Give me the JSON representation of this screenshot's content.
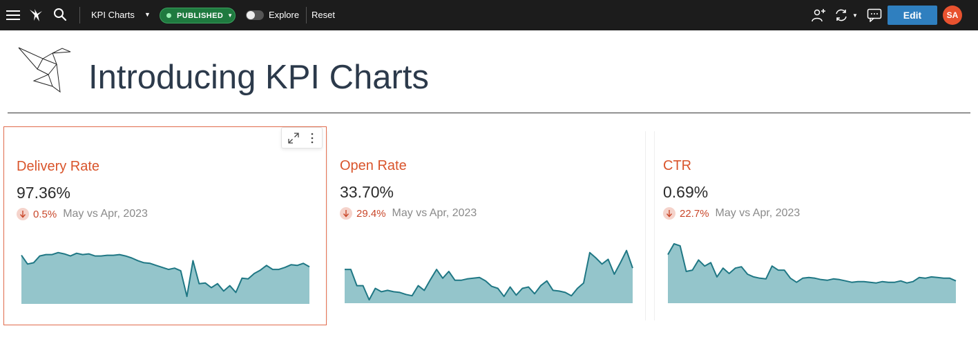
{
  "topbar": {
    "dashboard_name": "KPI Charts",
    "status_badge": "PUBLISHED",
    "explore_label": "Explore",
    "reset_label": "Reset",
    "edit_label": "Edit",
    "avatar_initials": "SA"
  },
  "page": {
    "title": "Introducing KPI Charts"
  },
  "colors": {
    "accent": "#d9542b",
    "spark_fill": "#94c5cb",
    "spark_line": "#1f7784",
    "edit_button": "#2f7fbf",
    "published": "#1f7a3f"
  },
  "cards": [
    {
      "title": "Delivery Rate",
      "value": "97.36%",
      "delta": "0.5%",
      "comparison": "May vs Apr, 2023",
      "direction": "down",
      "spark": [
        72,
        59,
        61,
        71,
        73,
        73,
        76,
        74,
        71,
        75,
        73,
        74,
        71,
        71,
        72,
        72,
        73,
        71,
        68,
        64,
        61,
        60,
        57,
        54,
        51,
        53,
        49,
        11,
        64,
        30,
        31,
        24,
        30,
        19,
        27,
        17,
        38,
        37,
        45,
        50,
        57,
        51,
        51,
        54,
        58,
        57,
        60,
        55
      ]
    },
    {
      "title": "Open Rate",
      "value": "33.70%",
      "delta": "29.4%",
      "comparison": "May vs Apr, 2023",
      "direction": "down",
      "spark": [
        50,
        50,
        26,
        26,
        5,
        22,
        17,
        19,
        17,
        16,
        13,
        11,
        26,
        19,
        35,
        50,
        37,
        47,
        34,
        34,
        36,
        37,
        38,
        33,
        25,
        22,
        10,
        24,
        12,
        22,
        24,
        14,
        26,
        33,
        19,
        18,
        16,
        11,
        22,
        30,
        75,
        67,
        58,
        65,
        43,
        60,
        78,
        52
      ]
    },
    {
      "title": "CTR",
      "value": "0.69%",
      "delta": "22.7%",
      "comparison": "May vs Apr, 2023",
      "direction": "down",
      "spark": [
        72,
        88,
        85,
        47,
        49,
        64,
        55,
        60,
        39,
        52,
        44,
        52,
        54,
        43,
        39,
        37,
        36,
        55,
        49,
        49,
        37,
        31,
        37,
        38,
        37,
        35,
        34,
        36,
        35,
        33,
        31,
        32,
        32,
        31,
        30,
        32,
        31,
        31,
        33,
        30,
        32,
        38,
        37,
        39,
        38,
        37,
        37,
        33
      ]
    }
  ]
}
